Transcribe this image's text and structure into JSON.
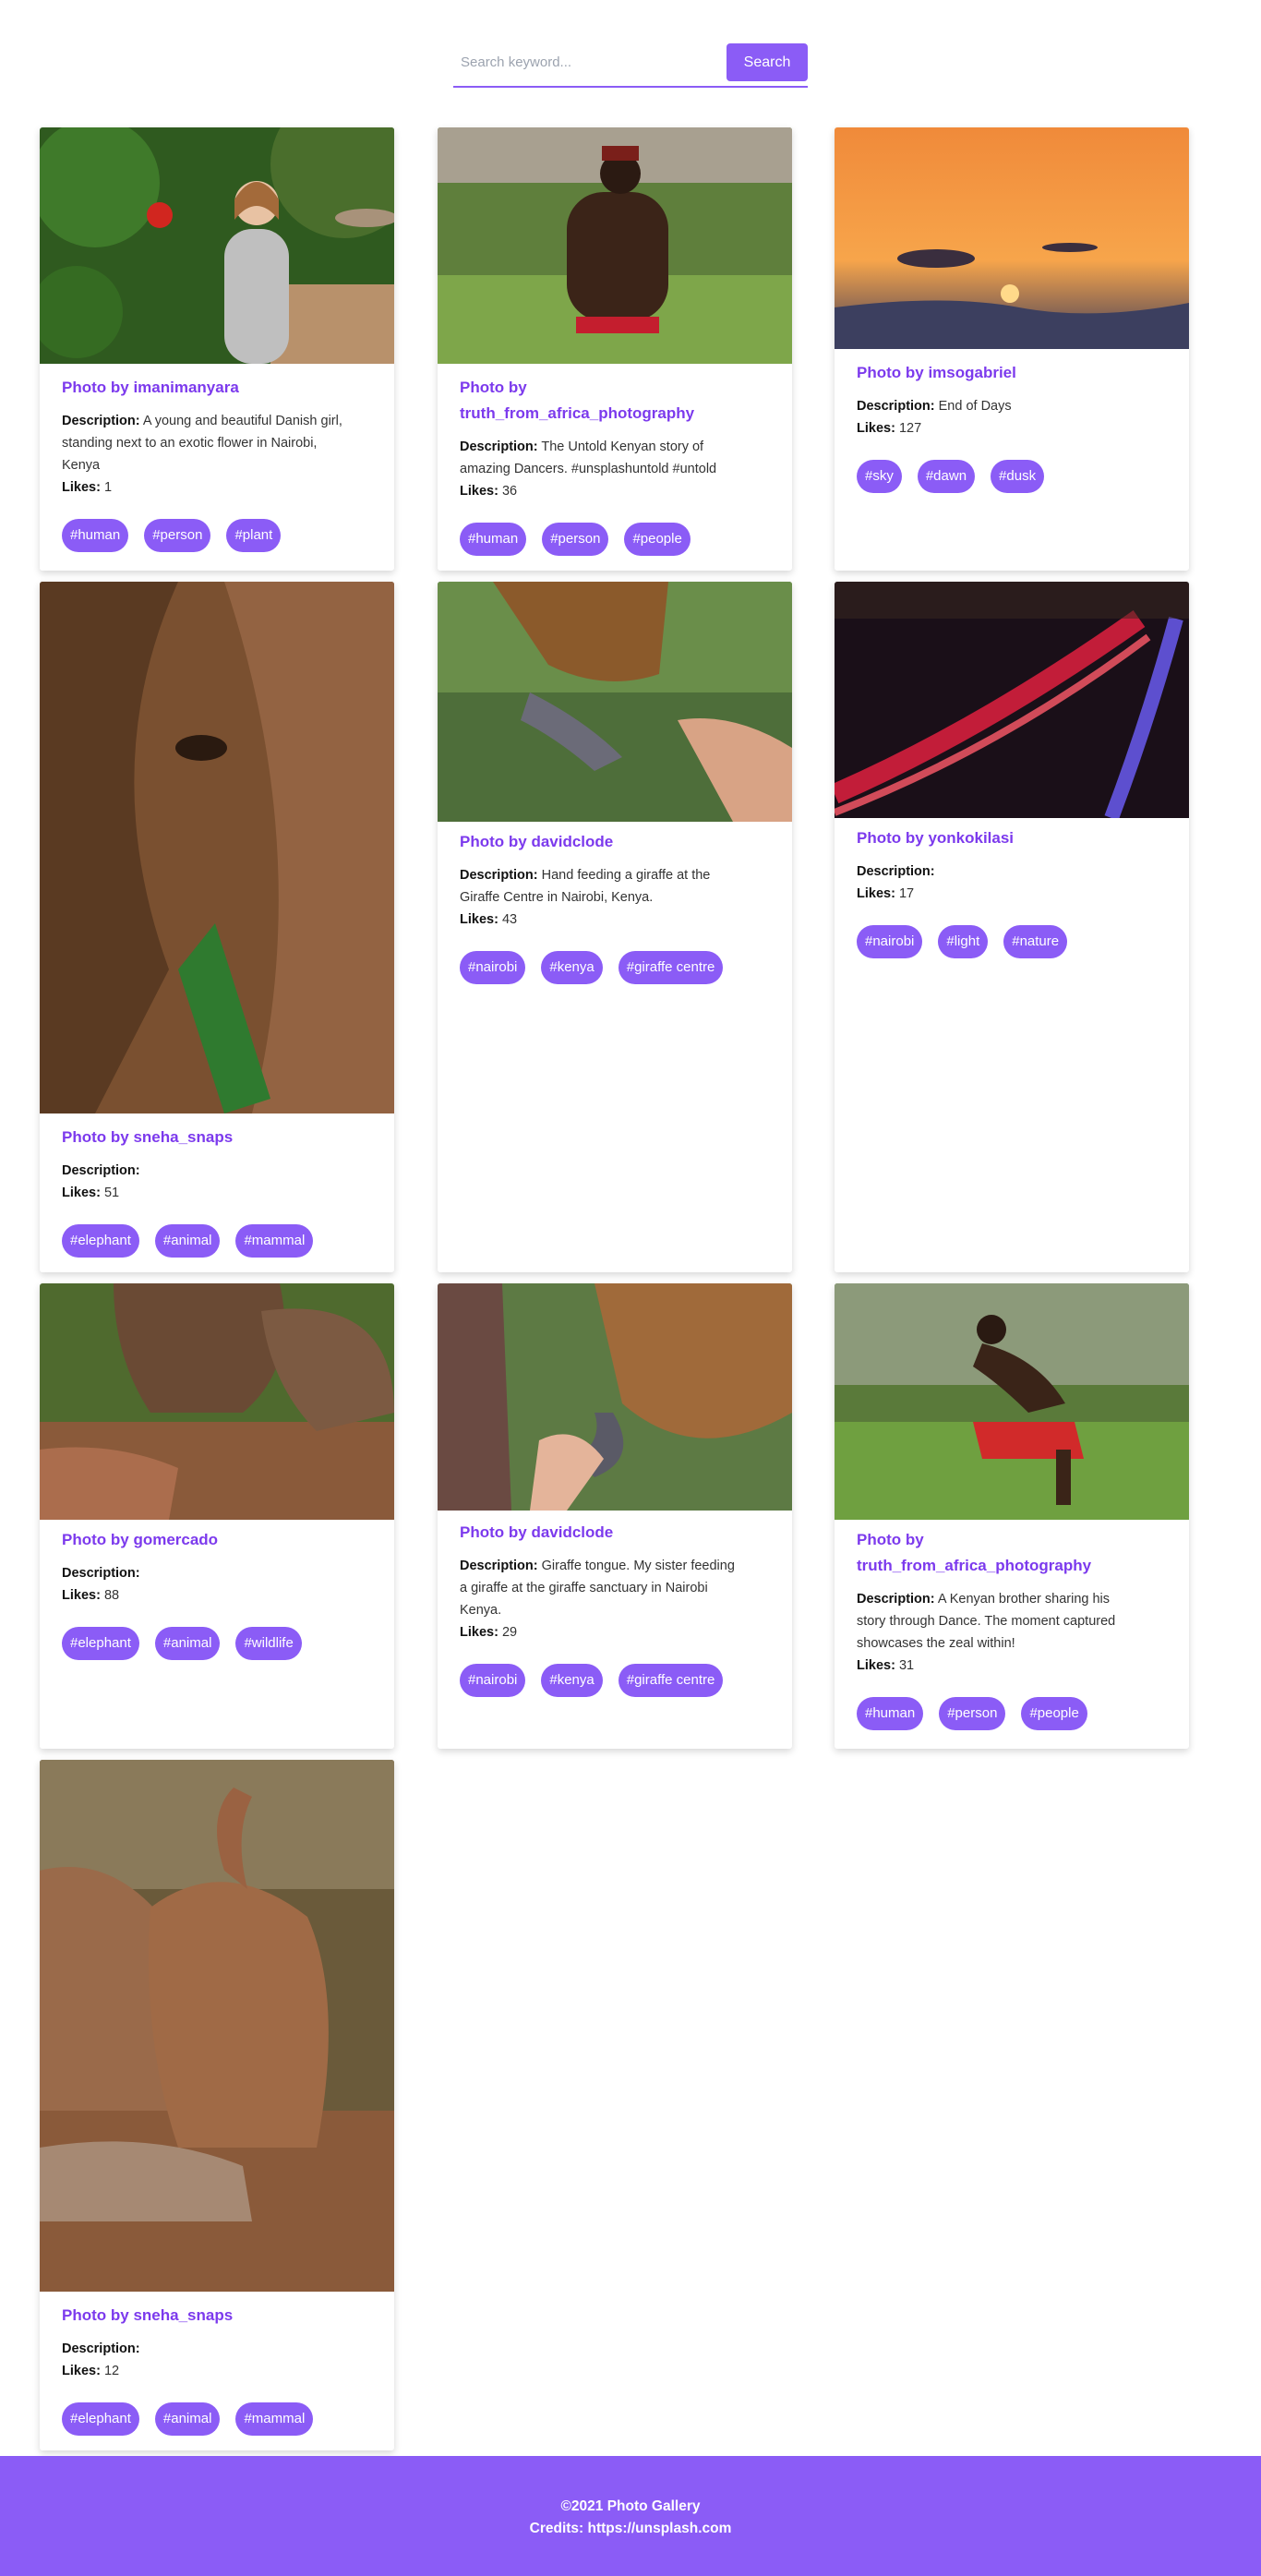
{
  "search": {
    "placeholder": "Search keyword...",
    "value": "",
    "button_label": "Search"
  },
  "labels": {
    "description": "Description:",
    "likes": "Likes:"
  },
  "cards": [
    {
      "title": "Photo by imanimanyara",
      "title_lines": [
        "Photo by imanimanyara"
      ],
      "description_lines": [
        "A young and beautiful Danish girl,",
        "standing next to an exotic flower in Nairobi,",
        "Kenya"
      ],
      "likes": "1",
      "tags": [
        "#human",
        "#person",
        "#plant"
      ]
    },
    {
      "title": "Photo by truth_from_africa_photography",
      "title_lines": [
        "Photo by",
        "truth_from_africa_photography"
      ],
      "description_lines": [
        "The Untold Kenyan story of",
        "amazing Dancers. #unsplashuntold #untold"
      ],
      "likes": "36",
      "tags": [
        "#human",
        "#person",
        "#people"
      ]
    },
    {
      "title": "Photo by imsogabriel",
      "title_lines": [
        "Photo by imsogabriel"
      ],
      "description_lines": [
        "End of Days"
      ],
      "likes": "127",
      "tags": [
        "#sky",
        "#dawn",
        "#dusk"
      ]
    },
    {
      "title": "Photo by sneha_snaps",
      "title_lines": [
        "Photo by sneha_snaps"
      ],
      "description_lines": [
        ""
      ],
      "likes": "51",
      "tags": [
        "#elephant",
        "#animal",
        "#mammal"
      ]
    },
    {
      "title": "Photo by davidclode",
      "title_lines": [
        "Photo by davidclode"
      ],
      "description_lines": [
        "Hand feeding a giraffe at the",
        "Giraffe Centre in Nairobi, Kenya."
      ],
      "likes": "43",
      "tags": [
        "#nairobi",
        "#kenya",
        "#giraffe centre"
      ]
    },
    {
      "title": "Photo by yonkokilasi",
      "title_lines": [
        "Photo by yonkokilasi"
      ],
      "description_lines": [
        ""
      ],
      "likes": "17",
      "tags": [
        "#nairobi",
        "#light",
        "#nature"
      ]
    },
    {
      "title": "Photo by gomercado",
      "title_lines": [
        "Photo by gomercado"
      ],
      "description_lines": [
        ""
      ],
      "likes": "88",
      "tags": [
        "#elephant",
        "#animal",
        "#wildlife"
      ]
    },
    {
      "title": "Photo by davidclode",
      "title_lines": [
        "Photo by davidclode"
      ],
      "description_lines": [
        "Giraffe tongue. My sister feeding",
        "a giraffe at the giraffe sanctuary in Nairobi",
        "Kenya."
      ],
      "likes": "29",
      "tags": [
        "#nairobi",
        "#kenya",
        "#giraffe centre"
      ]
    },
    {
      "title": "Photo by truth_from_africa_photography",
      "title_lines": [
        "Photo by",
        "truth_from_africa_photography"
      ],
      "description_lines": [
        "A Kenyan brother sharing his",
        "story through Dance. The moment captured",
        "showcases the zeal within!"
      ],
      "likes": "31",
      "tags": [
        "#human",
        "#person",
        "#people"
      ]
    },
    {
      "title": "Photo by sneha_snaps",
      "title_lines": [
        "Photo by sneha_snaps"
      ],
      "description_lines": [
        ""
      ],
      "likes": "12",
      "tags": [
        "#elephant",
        "#animal",
        "#mammal"
      ]
    }
  ],
  "footer": {
    "copyright": "©2021 Photo Gallery",
    "credits": "Credits: https://unsplash.com"
  },
  "colors": {
    "accent": "#8b5cf6",
    "title": "#7c3aed"
  }
}
